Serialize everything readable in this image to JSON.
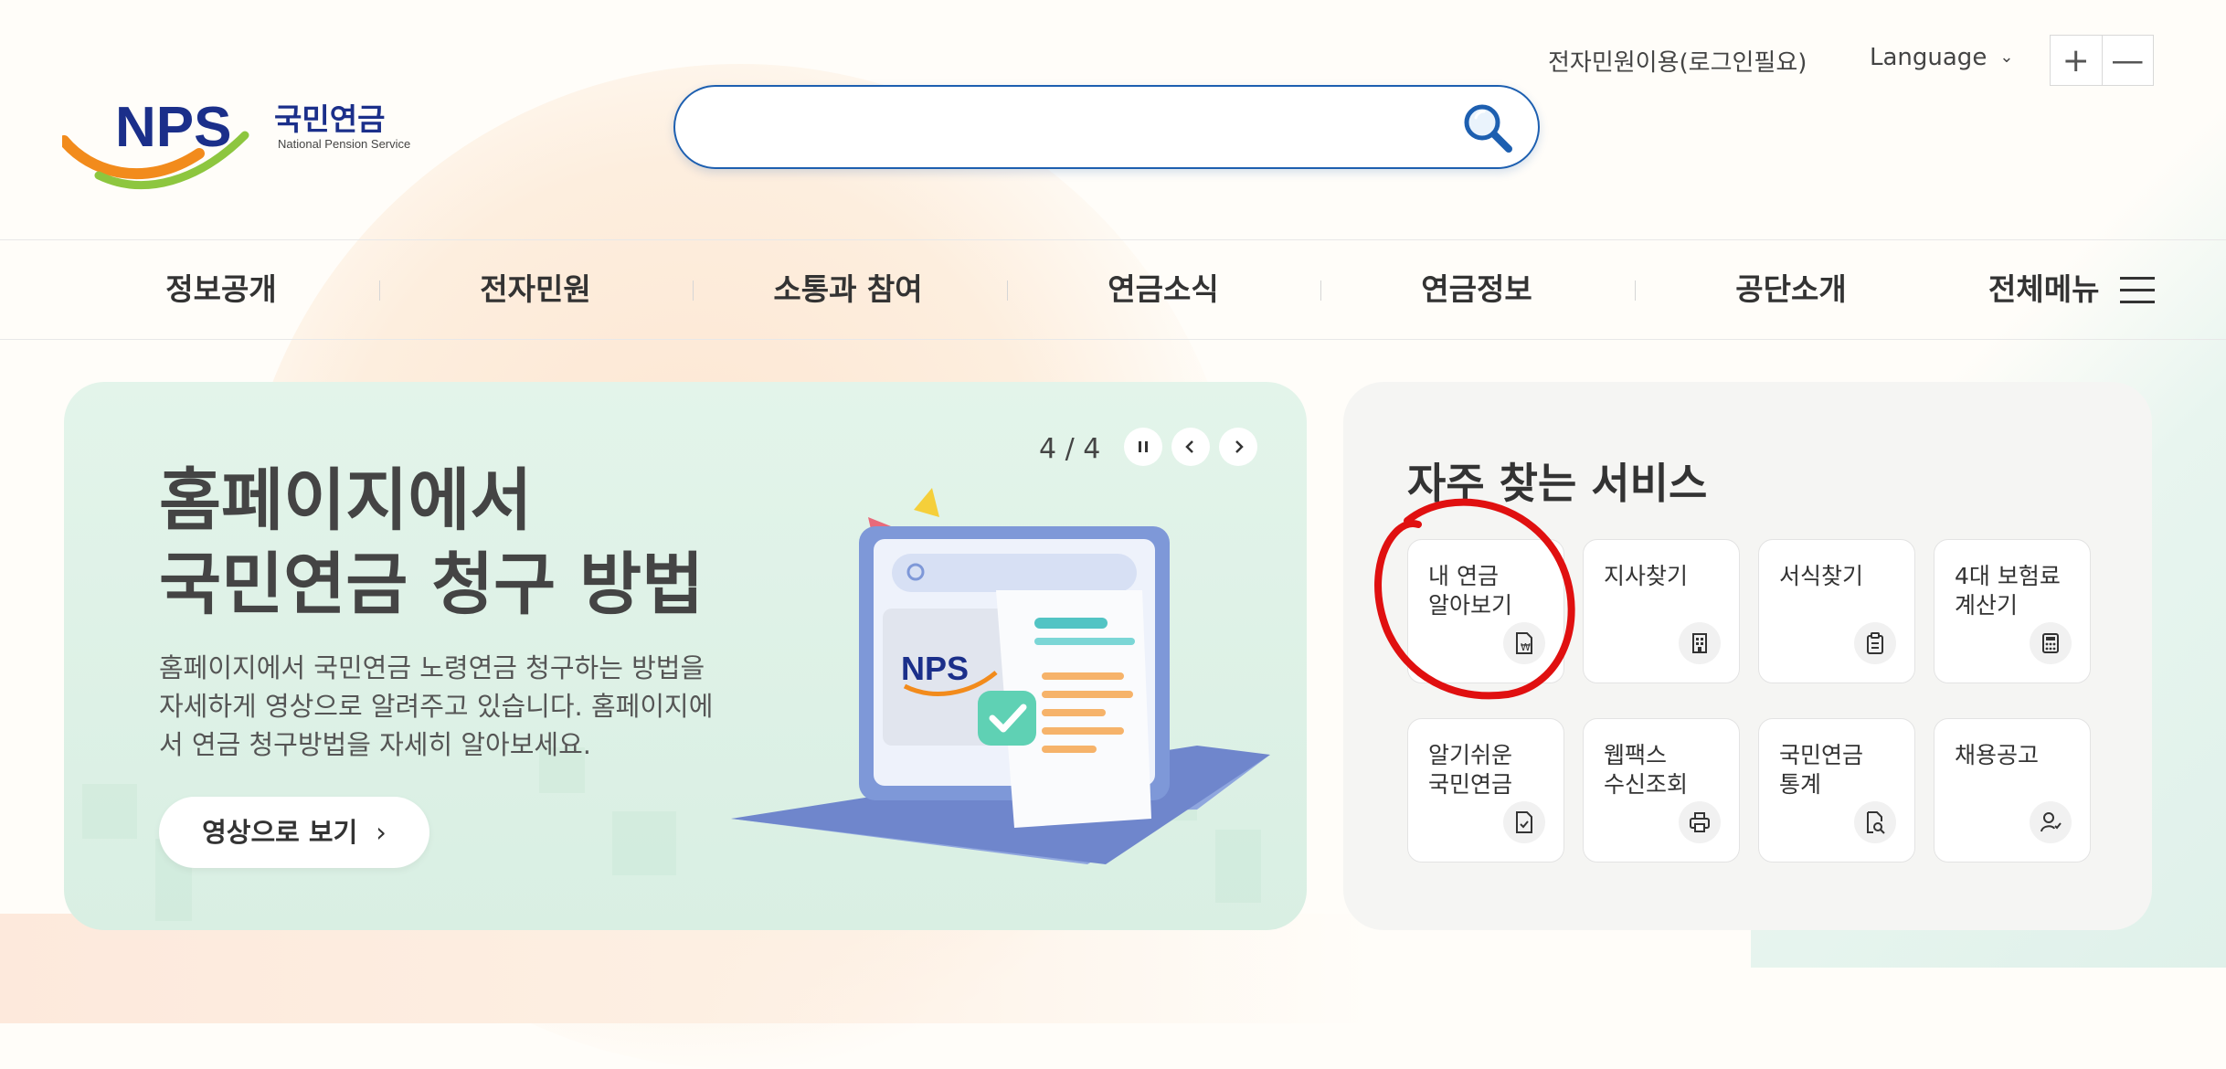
{
  "header": {
    "logo": {
      "mark": "NPS",
      "korean": "국민연금",
      "english": "National Pension Service"
    },
    "search": {
      "placeholder": "",
      "value": ""
    },
    "util": {
      "minwon_label": "전자민원이용(로그인필요)",
      "language_label": "Language"
    },
    "zoom": {
      "plus": "+",
      "minus": "—"
    }
  },
  "nav": {
    "items": [
      "정보공개",
      "전자민원",
      "소통과 참여",
      "연금소식",
      "연금정보",
      "공단소개"
    ],
    "all_menu_label": "전체메뉴"
  },
  "banner": {
    "title_line1": "홈페이지에서",
    "title_line2": "국민연금 청구 방법",
    "desc_line1": "홈페이지에서 국민연금 노령연금 청구하는 방법을",
    "desc_line2": "자세하게 영상으로 알려주고 있습니다. 홈페이지에",
    "desc_line3": "서 연금 청구방법을 자세히 알아보세요.",
    "button_label": "영상으로 보기",
    "slide_counter": "4 / 4",
    "illustration_logo": "NPS"
  },
  "services": {
    "title": "자주 찾는 서비스",
    "items": [
      {
        "label": "내 연금\n알아보기",
        "icon": "won-document-icon"
      },
      {
        "label": "지사찾기",
        "icon": "building-icon"
      },
      {
        "label": "서식찾기",
        "icon": "clipboard-icon"
      },
      {
        "label": "4대 보험료\n계산기",
        "icon": "calculator-icon"
      },
      {
        "label": "알기쉬운\n국민연금",
        "icon": "document-check-icon"
      },
      {
        "label": "웹팩스\n수신조회",
        "icon": "printer-icon"
      },
      {
        "label": "국민연금\n통계",
        "icon": "document-search-icon"
      },
      {
        "label": "채용공고",
        "icon": "user-check-icon"
      }
    ]
  },
  "colors": {
    "brand_blue": "#1d5fb0",
    "banner_bg": "#e3f4ea",
    "annotation_red": "#e01010"
  }
}
